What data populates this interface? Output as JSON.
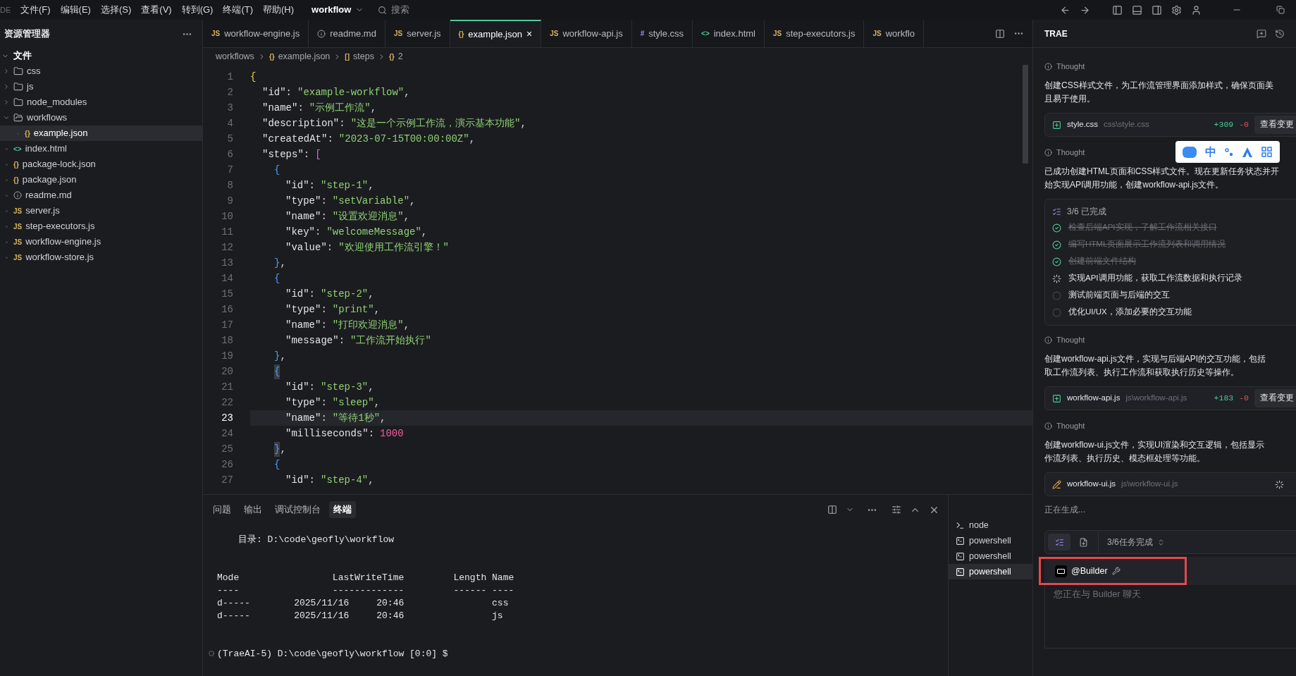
{
  "menu_bar": {
    "cut_label": "DE",
    "menus": [
      "文件(F)",
      "编辑(E)",
      "选择(S)",
      "查看(V)",
      "转到(G)",
      "终端(T)",
      "帮助(H)"
    ],
    "project": "workflow",
    "search": {
      "placeholder": "搜索"
    }
  },
  "explorer": {
    "title": "资源管理器",
    "section": {
      "label": "文件",
      "expanded": true
    },
    "tree": [
      {
        "name": "css",
        "kind": "folder",
        "expanded": false,
        "selected": false
      },
      {
        "name": "js",
        "kind": "folder",
        "expanded": false,
        "selected": false
      },
      {
        "name": "node_modules",
        "kind": "folder",
        "expanded": false,
        "selected": false
      },
      {
        "name": "workflows",
        "kind": "folder",
        "expanded": true,
        "selected": false,
        "children": [
          {
            "name": "example.json",
            "badge": "{}",
            "selected": true
          }
        ]
      },
      {
        "name": "index.html",
        "badge": "<>",
        "selected": false
      },
      {
        "name": "package-lock.json",
        "badge": "{}",
        "selected": false
      },
      {
        "name": "package.json",
        "badge": "{}",
        "selected": false
      },
      {
        "name": "readme.md",
        "kind": "info",
        "selected": false
      },
      {
        "name": "server.js",
        "badge": "JS",
        "selected": false
      },
      {
        "name": "step-executors.js",
        "badge": "JS",
        "selected": false
      },
      {
        "name": "workflow-engine.js",
        "badge": "JS",
        "selected": false
      },
      {
        "name": "workflow-store.js",
        "badge": "JS",
        "selected": false
      }
    ]
  },
  "editor_tabs": [
    {
      "label": "workflow-engine.js",
      "badge": "JS",
      "selected": false
    },
    {
      "label": "readme.md",
      "kind": "info",
      "selected": false
    },
    {
      "label": "server.js",
      "badge": "JS",
      "selected": false
    },
    {
      "label": "example.json",
      "badge": "{}",
      "selected": true,
      "close": "×"
    },
    {
      "label": "workflow-api.js",
      "badge": "JS",
      "selected": false
    },
    {
      "label": "style.css",
      "badge": "#",
      "selected": false
    },
    {
      "label": "index.html",
      "badge": "<>",
      "selected": false
    },
    {
      "label": "step-executors.js",
      "badge": "JS",
      "selected": false
    },
    {
      "label": "workflo",
      "badge": "JS",
      "selected": false
    }
  ],
  "breadcrumb": [
    {
      "label": "workflows"
    },
    {
      "badge": "{}",
      "label": "example.json"
    },
    {
      "badge": "[]",
      "label": "steps"
    },
    {
      "badge": "{}",
      "label": "2"
    }
  ],
  "code": [
    {
      "n": "1",
      "kind": "root",
      "current": false,
      "tokens": [
        {
          "kind": "b1",
          "text": "{"
        }
      ]
    },
    {
      "n": "2",
      "kind": "field",
      "current": false,
      "tokens": [
        {
          "kind": "key",
          "text": "\"id\""
        },
        {
          "kind": "p",
          "text": ":"
        },
        {
          "kind": "str",
          "text": "\"example-workflow\""
        },
        {
          "kind": "p",
          "text": ","
        }
      ]
    },
    {
      "n": "3",
      "kind": "field",
      "current": false,
      "tokens": [
        {
          "kind": "key",
          "text": "\"name\""
        },
        {
          "kind": "p",
          "text": ":"
        },
        {
          "kind": "str",
          "text": "\"示例工作流\""
        },
        {
          "kind": "p",
          "text": ","
        }
      ]
    },
    {
      "n": "4",
      "kind": "field",
      "current": false,
      "tokens": [
        {
          "kind": "key",
          "text": "\"description\""
        },
        {
          "kind": "p",
          "text": ":"
        },
        {
          "kind": "str",
          "text": "\"这是一个示例工作流，演示基本功能\""
        },
        {
          "kind": "p",
          "text": ","
        }
      ]
    },
    {
      "n": "5",
      "kind": "field",
      "current": false,
      "tokens": [
        {
          "kind": "key",
          "text": "\"createdAt\""
        },
        {
          "kind": "p",
          "text": ":"
        },
        {
          "kind": "str",
          "text": "\"2023-07-15T00:00:00Z\""
        },
        {
          "kind": "p",
          "text": ","
        }
      ]
    },
    {
      "n": "6",
      "kind": "field",
      "current": false,
      "tokens": [
        {
          "kind": "key",
          "text": "\"steps\""
        },
        {
          "kind": "p",
          "text": ":"
        },
        {
          "kind": "b2",
          "text": "["
        }
      ]
    },
    {
      "n": "7",
      "kind": "item",
      "current": false,
      "tokens": [
        {
          "kind": "b3",
          "text": "{"
        }
      ]
    },
    {
      "n": "8",
      "kind": "item_field",
      "current": false,
      "tokens": [
        {
          "kind": "key",
          "text": "\"id\""
        },
        {
          "kind": "p",
          "text": ":"
        },
        {
          "kind": "str",
          "text": "\"step-1\""
        },
        {
          "kind": "p",
          "text": ","
        }
      ]
    },
    {
      "n": "9",
      "kind": "item_field",
      "current": false,
      "tokens": [
        {
          "kind": "key",
          "text": "\"type\""
        },
        {
          "kind": "p",
          "text": ":"
        },
        {
          "kind": "str",
          "text": "\"setVariable\""
        },
        {
          "kind": "p",
          "text": ","
        }
      ]
    },
    {
      "n": "10",
      "kind": "item_field",
      "current": false,
      "tokens": [
        {
          "kind": "key",
          "text": "\"name\""
        },
        {
          "kind": "p",
          "text": ":"
        },
        {
          "kind": "str",
          "text": "\"设置欢迎消息\""
        },
        {
          "kind": "p",
          "text": ","
        }
      ]
    },
    {
      "n": "11",
      "kind": "item_field",
      "current": false,
      "tokens": [
        {
          "kind": "key",
          "text": "\"key\""
        },
        {
          "kind": "p",
          "text": ":"
        },
        {
          "kind": "str",
          "text": "\"welcomeMessage\""
        },
        {
          "kind": "p",
          "text": ","
        }
      ]
    },
    {
      "n": "12",
      "kind": "item_field",
      "current": false,
      "tokens": [
        {
          "kind": "key",
          "text": "\"value\""
        },
        {
          "kind": "p",
          "text": ":"
        },
        {
          "kind": "str",
          "text": "\"欢迎使用工作流引擎！\""
        }
      ]
    },
    {
      "n": "13",
      "kind": "item",
      "current": false,
      "tokens": [
        {
          "kind": "b3",
          "text": "}"
        },
        {
          "kind": "p",
          "text": ","
        }
      ]
    },
    {
      "n": "14",
      "kind": "item",
      "current": false,
      "tokens": [
        {
          "kind": "b3",
          "text": "{"
        }
      ]
    },
    {
      "n": "15",
      "kind": "item_field",
      "current": false,
      "tokens": [
        {
          "kind": "key",
          "text": "\"id\""
        },
        {
          "kind": "p",
          "text": ":"
        },
        {
          "kind": "str",
          "text": "\"step-2\""
        },
        {
          "kind": "p",
          "text": ","
        }
      ]
    },
    {
      "n": "16",
      "kind": "item_field",
      "current": false,
      "tokens": [
        {
          "kind": "key",
          "text": "\"type\""
        },
        {
          "kind": "p",
          "text": ":"
        },
        {
          "kind": "str",
          "text": "\"print\""
        },
        {
          "kind": "p",
          "text": ","
        }
      ]
    },
    {
      "n": "17",
      "kind": "item_field",
      "current": false,
      "tokens": [
        {
          "kind": "key",
          "text": "\"name\""
        },
        {
          "kind": "p",
          "text": ":"
        },
        {
          "kind": "str",
          "text": "\"打印欢迎消息\""
        },
        {
          "kind": "p",
          "text": ","
        }
      ]
    },
    {
      "n": "18",
      "kind": "item_field",
      "current": false,
      "tokens": [
        {
          "kind": "key",
          "text": "\"message\""
        },
        {
          "kind": "p",
          "text": ":"
        },
        {
          "kind": "str",
          "text": "\"工作流开始执行\""
        }
      ]
    },
    {
      "n": "19",
      "kind": "item",
      "current": false,
      "tokens": [
        {
          "kind": "b3",
          "text": "}"
        },
        {
          "kind": "p",
          "text": ","
        }
      ]
    },
    {
      "n": "20",
      "kind": "item",
      "current": false,
      "tokens": [
        {
          "kind": "match",
          "text": "{"
        }
      ]
    },
    {
      "n": "21",
      "kind": "item_field",
      "current": false,
      "tokens": [
        {
          "kind": "key",
          "text": "\"id\""
        },
        {
          "kind": "p",
          "text": ":"
        },
        {
          "kind": "str",
          "text": "\"step-3\""
        },
        {
          "kind": "p",
          "text": ","
        }
      ]
    },
    {
      "n": "22",
      "kind": "item_field",
      "current": false,
      "tokens": [
        {
          "kind": "key",
          "text": "\"type\""
        },
        {
          "kind": "p",
          "text": ":"
        },
        {
          "kind": "str",
          "text": "\"sleep\""
        },
        {
          "kind": "p",
          "text": ","
        }
      ]
    },
    {
      "n": "23",
      "kind": "item_field",
      "current": true,
      "tokens": [
        {
          "kind": "key",
          "text": "\"name\""
        },
        {
          "kind": "p",
          "text": ":"
        },
        {
          "kind": "str",
          "text": "\"等待1秒\""
        },
        {
          "kind": "p",
          "text": ","
        }
      ]
    },
    {
      "n": "24",
      "kind": "item_field",
      "current": false,
      "tokens": [
        {
          "kind": "key",
          "text": "\"milliseconds\""
        },
        {
          "kind": "p",
          "text": ":"
        },
        {
          "kind": "num",
          "text": "1000"
        }
      ]
    },
    {
      "n": "25",
      "kind": "item",
      "current": false,
      "tokens": [
        {
          "kind": "match",
          "text": "}"
        },
        {
          "kind": "p",
          "text": ","
        }
      ]
    },
    {
      "n": "26",
      "kind": "item",
      "current": false,
      "tokens": [
        {
          "kind": "b3",
          "text": "{"
        }
      ]
    },
    {
      "n": "27",
      "kind": "item_field",
      "current": false,
      "tokens": [
        {
          "kind": "key",
          "text": "\"id\""
        },
        {
          "kind": "p",
          "text": ":"
        },
        {
          "kind": "str",
          "text": "\"step-4\""
        },
        {
          "kind": "p",
          "text": ","
        }
      ]
    }
  ],
  "panel_tabs": [
    {
      "label": "问题",
      "selected": false
    },
    {
      "label": "输出",
      "selected": false
    },
    {
      "label": "调试控制台",
      "selected": false
    },
    {
      "label": "终端",
      "selected": true
    }
  ],
  "terminal": {
    "directory": "目录: D:\\code\\geofly\\workflow",
    "table": [
      "Mode                 LastWriteTime         Length Name",
      "----                 -------------         ------ ----",
      "d-----        2025/11/16     20:46                css",
      "d-----        2025/11/16     20:46                js"
    ],
    "prompt": "(TraeAI-5) D:\\code\\geofly\\workflow [0:0] $"
  },
  "terminals": [
    {
      "label": "node",
      "selected": false
    },
    {
      "label": "powershell",
      "selected": false
    },
    {
      "label": "powershell",
      "selected": false
    },
    {
      "label": "powershell",
      "selected": true
    }
  ],
  "assistant": {
    "title": "TRAE",
    "blocks": [
      {
        "kind": "thought",
        "label": "Thought"
      },
      {
        "kind": "paragraph",
        "lines": [
          "创建CSS样式文件，为工作流管理界面添加样式，确保页面美",
          "且易于使用。"
        ]
      },
      {
        "kind": "file_card",
        "generating": false,
        "name": "style.css",
        "path": "css\\style.css",
        "added": "+309",
        "removed": "-0",
        "button": "查看变更"
      },
      {
        "kind": "thought",
        "label": "Thought"
      },
      {
        "kind": "paragraph",
        "lines": [
          "已成功创建HTML页面和CSS样式文件。现在更新任务状态并开",
          "始实现API调用功能，创建workflow-api.js文件。"
        ]
      },
      {
        "kind": "todo",
        "title": "3/6 已完成",
        "items": [
          {
            "text": "检查后端API实现，了解工作流相关接口",
            "done": true,
            "in_progress": false
          },
          {
            "text": "编写HTML页面展示工作流列表和调用情况",
            "done": true,
            "in_progress": false
          },
          {
            "text": "创建前端文件结构",
            "done": true,
            "in_progress": false
          },
          {
            "text": "实现API调用功能，获取工作流数据和执行记录",
            "done": false,
            "in_progress": true
          },
          {
            "text": "测试前端页面与后端的交互",
            "done": false,
            "in_progress": false
          },
          {
            "text": "优化UI/UX，添加必要的交互功能",
            "done": false,
            "in_progress": false
          }
        ]
      },
      {
        "kind": "thought",
        "label": "Thought"
      },
      {
        "kind": "paragraph",
        "lines": [
          "创建workflow-api.js文件，实现与后端API的交互功能，包括",
          "取工作流列表、执行工作流和获取执行历史等操作。"
        ]
      },
      {
        "kind": "file_card",
        "generating": false,
        "name": "workflow-api.js",
        "path": "js\\workflow-api.js",
        "added": "+183",
        "removed": "-0",
        "button": "查看变更"
      },
      {
        "kind": "thought",
        "label": "Thought"
      },
      {
        "kind": "paragraph",
        "lines": [
          "创建workflow-ui.js文件，实现UI渲染和交互逻辑，包括显示",
          "作流列表、执行历史、模态框处理等功能。"
        ]
      },
      {
        "kind": "file_card",
        "generating": true,
        "name": "workflow-ui.js",
        "path": "js\\workflow-ui.js"
      },
      {
        "kind": "status",
        "text": "正在生成..."
      }
    ],
    "task_bar": {
      "label": "3/6任务完成"
    },
    "agent": {
      "label": "@Builder",
      "annotated": true
    },
    "input": {
      "placeholder": "您正在与 Builder 聊天"
    }
  },
  "ime_toolbar": {
    "mode": "中"
  }
}
